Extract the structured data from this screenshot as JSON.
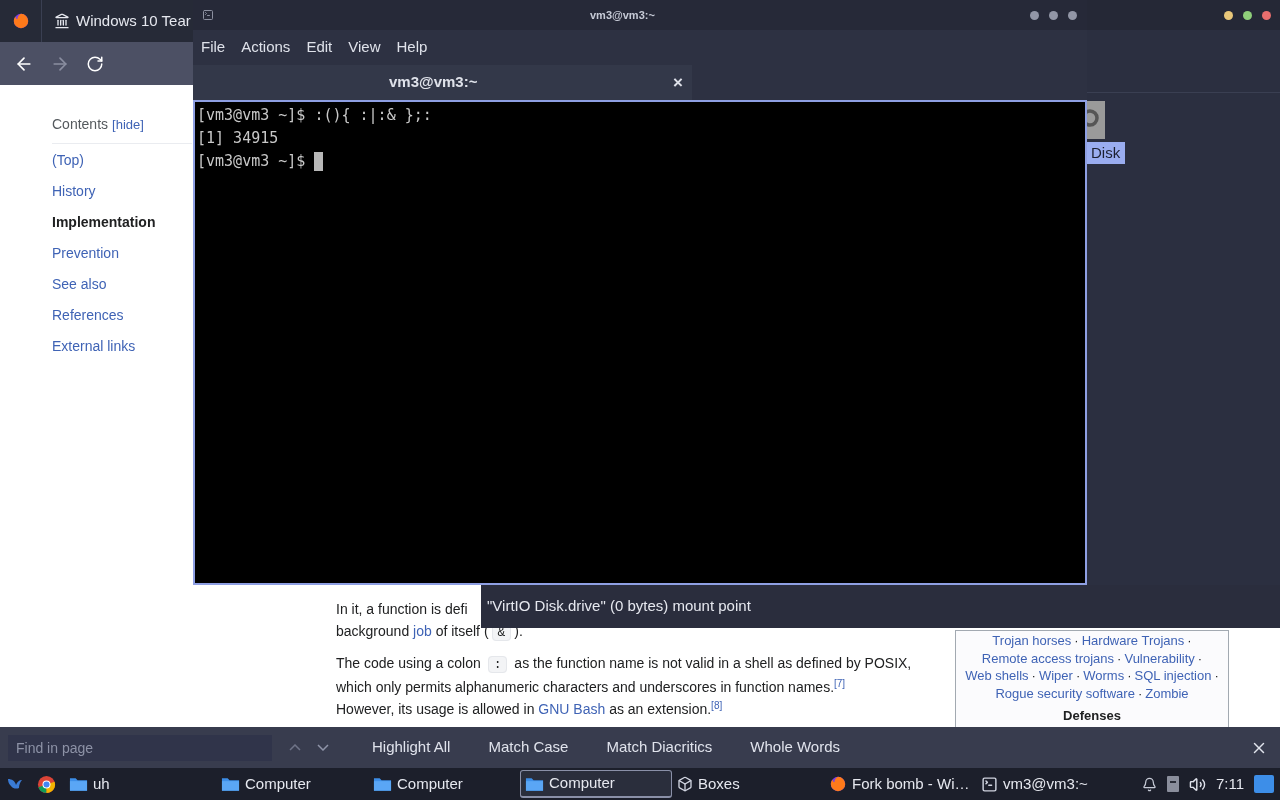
{
  "browser": {
    "tab": {
      "title": "Windows 10 Tear"
    },
    "back": {
      "disabled": false
    },
    "forward": {
      "disabled": true
    }
  },
  "contents": {
    "title": "Contents",
    "toggle": "[hide]",
    "items": [
      {
        "label": "(Top)",
        "selected": false
      },
      {
        "label": "History",
        "selected": false
      },
      {
        "label": "Implementation",
        "selected": true
      },
      {
        "label": "Prevention",
        "selected": false
      },
      {
        "label": "See also",
        "selected": false
      },
      {
        "label": "References",
        "selected": false
      },
      {
        "label": "External links",
        "selected": false
      }
    ]
  },
  "article": {
    "paragraphs": [
      [
        [
          {
            "kind": "text",
            "text": "In it, a function is defi"
          }
        ],
        [
          {
            "kind": "text",
            "text": "background "
          },
          {
            "kind": "link",
            "text": "job"
          },
          {
            "kind": "text",
            "text": " of itself ("
          },
          {
            "kind": "code",
            "text": "&"
          },
          {
            "kind": "text",
            "text": ")."
          }
        ]
      ],
      [
        [
          {
            "kind": "text",
            "text": "The code using a colon "
          },
          {
            "kind": "code",
            "text": ":"
          },
          {
            "kind": "text",
            "text": " as the function name is not valid in a shell as defined by POSIX,"
          }
        ],
        [
          {
            "kind": "text",
            "text": "which only permits alphanumeric characters and underscores in function names."
          },
          {
            "kind": "ref",
            "text": "[7]"
          }
        ],
        [
          {
            "kind": "text",
            "text": "However, its usage is allowed in "
          },
          {
            "kind": "link",
            "text": "GNU Bash"
          },
          {
            "kind": "text",
            "text": " as an extension."
          },
          {
            "kind": "ref",
            "text": "[8]"
          }
        ]
      ]
    ]
  },
  "navbox": {
    "separator": "·",
    "lines": [
      {
        "items": [
          "Trojan horses",
          "Hardware Trojans"
        ],
        "trailing": true
      },
      {
        "items": [
          "Remote access trojans",
          "Vulnerability"
        ],
        "trailing": true
      },
      {
        "items": [
          "Web shells",
          "Wiper",
          "Worms",
          "SQL injection"
        ],
        "trailing": true
      },
      {
        "items": [
          "Rogue security software",
          "Zombie"
        ],
        "trailing": false
      }
    ],
    "heading": "Defenses"
  },
  "find_bar": {
    "placeholder": "Find in page",
    "options": [
      "Highlight All",
      "Match Case",
      "Match Diacritics",
      "Whole Words"
    ]
  },
  "terminal": {
    "title": "vm3@vm3:~",
    "menu": [
      "File",
      "Actions",
      "Edit",
      "View",
      "Help"
    ],
    "tab": {
      "title": "vm3@vm3:~",
      "close": "×"
    },
    "lines": [
      "[vm3@vm3 ~]$ :(){ :|:& };:",
      "[1] 34915",
      "[vm3@vm3 ~]$ "
    ]
  },
  "file_manager": {
    "item_label": "Disk",
    "tooltip": "\"VirtIO Disk.drive\" (0 bytes) mount point"
  },
  "taskbar": {
    "items": [
      {
        "kind": "folder",
        "label": "uh",
        "selected": false
      },
      {
        "kind": "folder",
        "label": "Computer",
        "selected": false
      },
      {
        "kind": "folder",
        "label": "Computer",
        "selected": false
      },
      {
        "kind": "folder",
        "label": "Computer",
        "selected": true
      },
      {
        "kind": "boxes",
        "label": "Boxes",
        "selected": false
      },
      {
        "kind": "firefox",
        "label": "Fork bomb - Wi…",
        "selected": false
      },
      {
        "kind": "terminal",
        "label": "vm3@vm3:~",
        "selected": false
      }
    ],
    "clock": "7:11"
  }
}
